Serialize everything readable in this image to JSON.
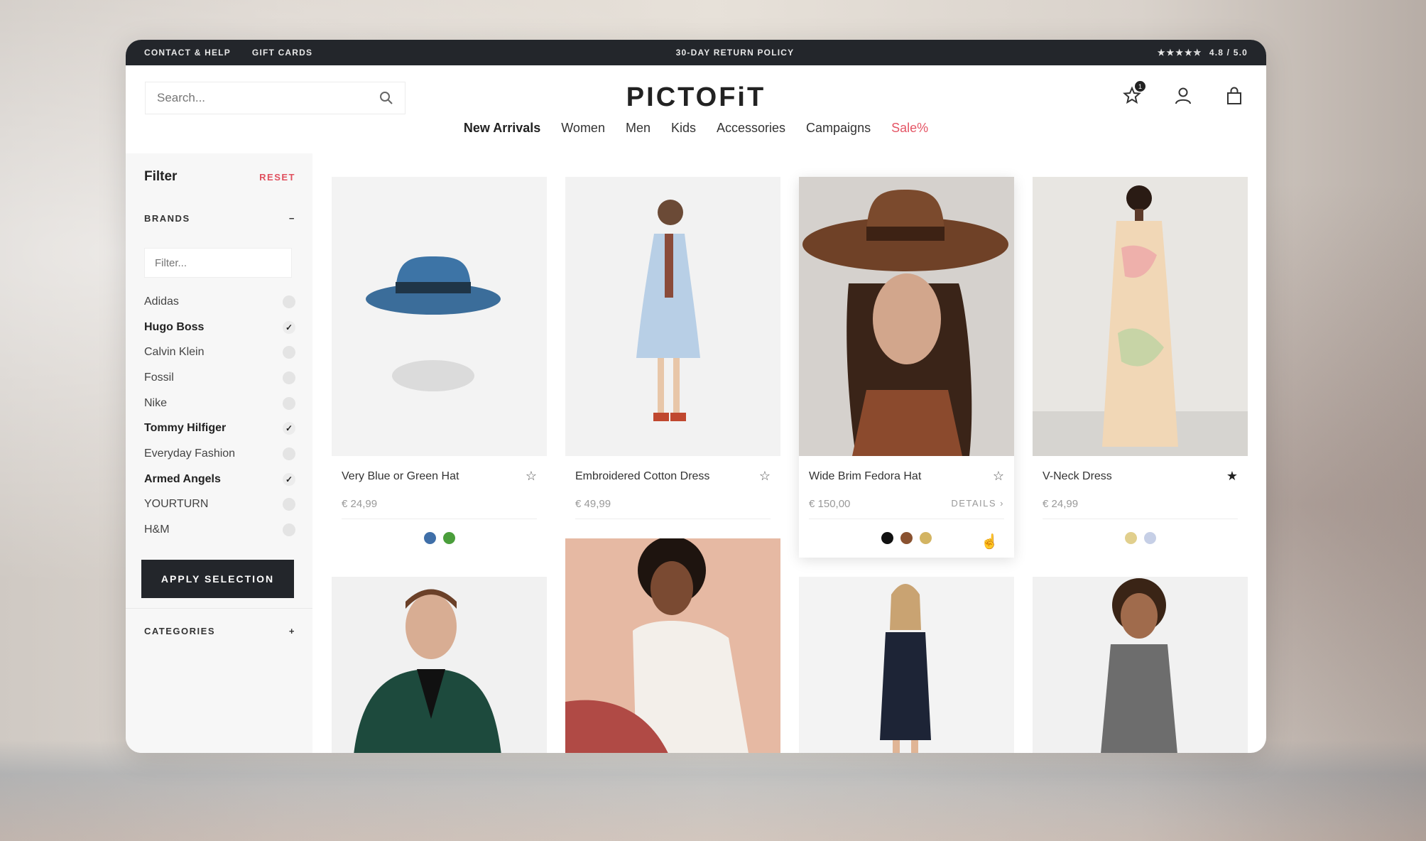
{
  "topbar": {
    "contact": "CONTACT & HELP",
    "gift_cards": "GIFT CARDS",
    "return_policy": "30-DAY RETURN POLICY",
    "stars": "★★★★✮",
    "rating": "4.8 / 5.0"
  },
  "header": {
    "search_placeholder": "Search...",
    "logo": "PICTOFiT",
    "wishlist_badge": "1"
  },
  "nav": {
    "items": [
      "New Arrivals",
      "Women",
      "Men",
      "Kids",
      "Accessories",
      "Campaigns",
      "Sale%"
    ]
  },
  "sidebar": {
    "filter_title": "Filter",
    "reset": "RESET",
    "brands_heading": "BRANDS",
    "brands_toggle": "−",
    "filter_placeholder": "Filter...",
    "brands": [
      {
        "name": "Adidas",
        "checked": false
      },
      {
        "name": "Hugo Boss",
        "checked": true
      },
      {
        "name": "Calvin Klein",
        "checked": false
      },
      {
        "name": "Fossil",
        "checked": false
      },
      {
        "name": "Nike",
        "checked": false
      },
      {
        "name": "Tommy Hilfiger",
        "checked": true
      },
      {
        "name": "Everyday Fashion",
        "checked": false
      },
      {
        "name": "Armed Angels",
        "checked": true
      },
      {
        "name": "YOURTURN",
        "checked": false
      },
      {
        "name": "H&M",
        "checked": false
      }
    ],
    "check_mark": "✓",
    "apply": "APPLY SELECTION",
    "categories_heading": "CATEGORIES",
    "categories_toggle": "+"
  },
  "products": [
    {
      "name": "Very Blue or Green Hat",
      "price": "€ 24,99",
      "starred": false,
      "swatches": [
        "#3f6fa8",
        "#4a9e3b"
      ]
    },
    {
      "name": "Embroidered Cotton Dress",
      "price": "€ 49,99",
      "starred": false,
      "swatches": []
    },
    {
      "name": "Wide Brim Fedora Hat",
      "price": "€ 150,00",
      "starred": false,
      "details": "DETAILS ›",
      "swatches": [
        "#111111",
        "#8a5230",
        "#d3b462"
      ]
    },
    {
      "name": "V-Neck Dress",
      "price": "€ 24,99",
      "starred": true,
      "swatches": [
        "#e1cf8d",
        "#c6cfe6"
      ]
    }
  ],
  "icons": {
    "star_empty": "☆",
    "star_filled": "★",
    "cursor": "☝"
  }
}
